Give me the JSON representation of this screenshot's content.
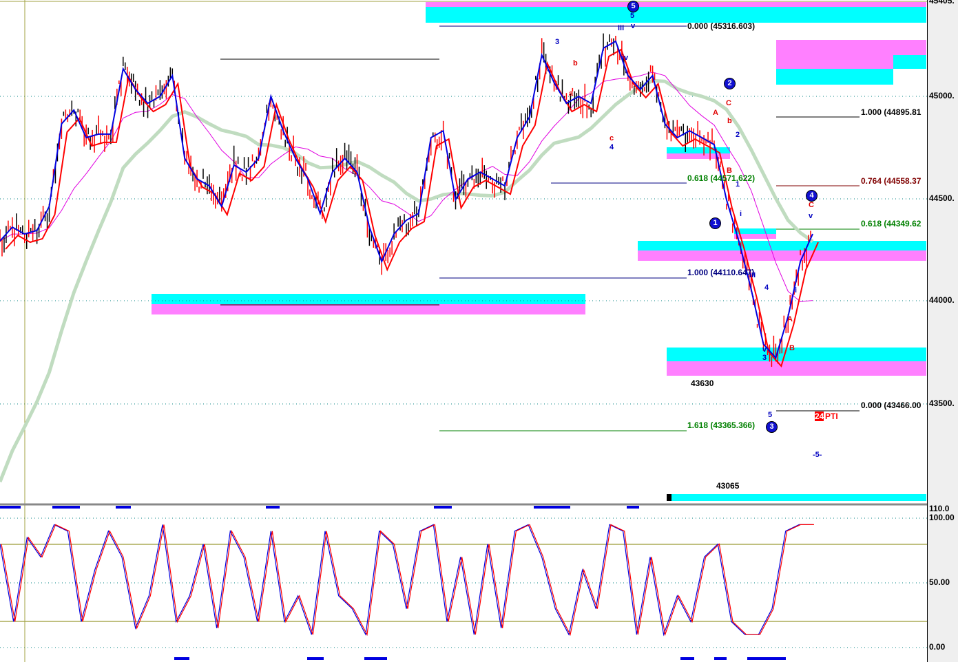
{
  "chart_data": {
    "type": "line",
    "title": "",
    "price_axis": {
      "ticks": [
        "45405.",
        "45000.",
        "44500.",
        "44000.",
        "43500."
      ],
      "ylim": [
        43100,
        45405
      ]
    },
    "oscillator_axis": {
      "ticks": [
        "110.0",
        "100.00",
        "50.00",
        "0.00"
      ],
      "ylim": [
        0,
        110
      ],
      "bands": [
        20,
        80
      ]
    },
    "series": [
      {
        "name": "price",
        "values": [
          44296,
          44363,
          44330,
          44347,
          44464,
          44866,
          44933,
          44799,
          44816,
          44816,
          45134,
          45034,
          44966,
          45000,
          45101,
          44698,
          44598,
          44564,
          44464,
          44665,
          44631,
          44698,
          45000,
          44832,
          44698,
          44598,
          44430,
          44631,
          44698,
          44631,
          44363,
          44196,
          44330,
          44397,
          44430,
          44799,
          44832,
          44497,
          44598,
          44631,
          44598,
          44564,
          44799,
          44899,
          45201,
          45067,
          44966,
          45000,
          44966,
          45235,
          45268,
          45101,
          45034,
          45101,
          44866,
          44799,
          44832,
          44799,
          44765,
          44497,
          44296,
          44062,
          43794,
          43727,
          43928,
          44196,
          44330
        ]
      },
      {
        "name": "oscillator",
        "values": [
          80,
          20,
          85,
          70,
          95,
          90,
          20,
          60,
          90,
          70,
          15,
          40,
          95,
          20,
          40,
          80,
          15,
          90,
          70,
          20,
          90,
          20,
          40,
          10,
          90,
          40,
          30,
          10,
          90,
          80,
          30,
          90,
          95,
          20,
          70,
          10,
          80,
          15,
          90,
          95,
          70,
          30,
          10,
          60,
          30,
          95,
          90,
          10,
          70,
          10,
          40,
          20,
          70,
          80,
          20,
          10,
          10,
          30,
          90,
          95,
          95
        ]
      }
    ],
    "fib_levels": [
      "0.000 (45316.603)",
      "0.618 (44571.622)",
      "1.000 (44110.647)",
      "1.618 (43365.366)",
      "1.000 (44895.81",
      "0.764 (44558.37",
      "0.618 (44349.62",
      "0.000 (43466.00"
    ],
    "annotations": {
      "low1": "43630",
      "low2": "43065",
      "pti_num": "24",
      "pti": "PTI",
      "five": "-5-"
    },
    "waves": [
      "5",
      "iii",
      "v",
      "iv",
      "3",
      "b",
      "a",
      "c",
      "4",
      "2",
      "C",
      "A",
      "b",
      "B",
      "c",
      "2",
      "1",
      "i",
      "ii",
      "iii",
      "4",
      "v",
      "3",
      "5",
      "4",
      "C",
      "v",
      "i",
      "A",
      "B"
    ],
    "circles": [
      "5",
      "2",
      "1",
      "4",
      "3"
    ],
    "colors": {
      "cyan": "#00ffff",
      "pink": "#ff80ff",
      "blue": "#0000e0",
      "red": "#ff0000",
      "ma": "#c0dcc0"
    }
  }
}
